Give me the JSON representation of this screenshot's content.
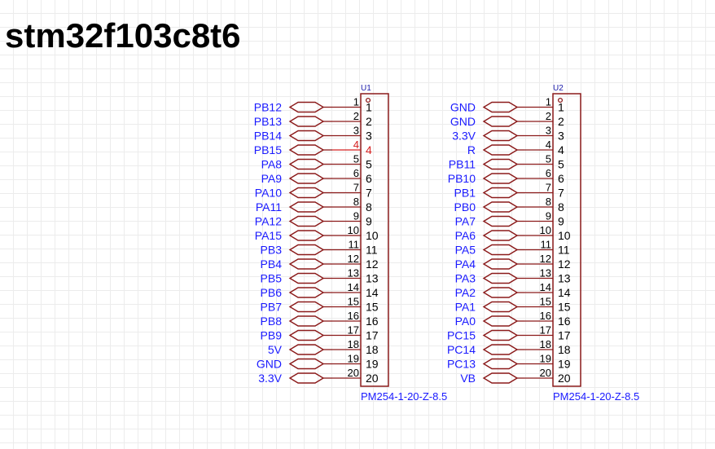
{
  "title": "stm32f103c8t6",
  "colors": {
    "wire": "#8b1a1a",
    "net_label": "#1a1aff",
    "pin_number": "#000000",
    "designator": "#1a1aaa",
    "pin1_marker": "#8b1a1a",
    "highlight_pin": "#d42020"
  },
  "components": [
    {
      "designator": "U1",
      "footprint": "PM254-1-20-Z-8.5",
      "highlight_pin": 4,
      "pins": [
        {
          "number": "1",
          "net": "PB12"
        },
        {
          "number": "2",
          "net": "PB13"
        },
        {
          "number": "3",
          "net": "PB14"
        },
        {
          "number": "4",
          "net": "PB15"
        },
        {
          "number": "5",
          "net": "PA8"
        },
        {
          "number": "6",
          "net": "PA9"
        },
        {
          "number": "7",
          "net": "PA10"
        },
        {
          "number": "8",
          "net": "PA11"
        },
        {
          "number": "9",
          "net": "PA12"
        },
        {
          "number": "10",
          "net": "PA15"
        },
        {
          "number": "11",
          "net": "PB3"
        },
        {
          "number": "12",
          "net": "PB4"
        },
        {
          "number": "13",
          "net": "PB5"
        },
        {
          "number": "14",
          "net": "PB6"
        },
        {
          "number": "15",
          "net": "PB7"
        },
        {
          "number": "16",
          "net": "PB8"
        },
        {
          "number": "17",
          "net": "PB9"
        },
        {
          "number": "18",
          "net": "5V"
        },
        {
          "number": "19",
          "net": "GND"
        },
        {
          "number": "20",
          "net": "3.3V"
        }
      ]
    },
    {
      "designator": "U2",
      "footprint": "PM254-1-20-Z-8.5",
      "highlight_pin": null,
      "pins": [
        {
          "number": "1",
          "net": "GND"
        },
        {
          "number": "2",
          "net": "GND"
        },
        {
          "number": "3",
          "net": "3.3V"
        },
        {
          "number": "4",
          "net": "R"
        },
        {
          "number": "5",
          "net": "PB11"
        },
        {
          "number": "6",
          "net": "PB10"
        },
        {
          "number": "7",
          "net": "PB1"
        },
        {
          "number": "8",
          "net": "PB0"
        },
        {
          "number": "9",
          "net": "PA7"
        },
        {
          "number": "10",
          "net": "PA6"
        },
        {
          "number": "11",
          "net": "PA5"
        },
        {
          "number": "12",
          "net": "PA4"
        },
        {
          "number": "13",
          "net": "PA3"
        },
        {
          "number": "14",
          "net": "PA2"
        },
        {
          "number": "15",
          "net": "PA1"
        },
        {
          "number": "16",
          "net": "PA0"
        },
        {
          "number": "17",
          "net": "PC15"
        },
        {
          "number": "18",
          "net": "PC14"
        },
        {
          "number": "19",
          "net": "PC13"
        },
        {
          "number": "20",
          "net": "VB"
        }
      ]
    }
  ]
}
